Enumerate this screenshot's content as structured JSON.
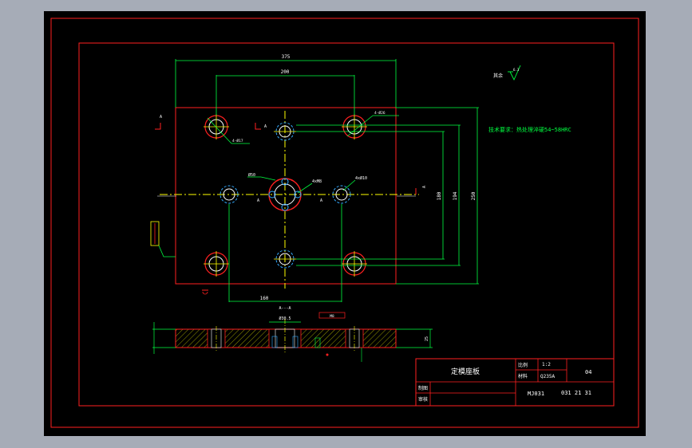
{
  "drawing": {
    "dimensions": {
      "overall_width": "375",
      "hole_spacing_width": "200",
      "bottom_width": "160",
      "overall_height": "250",
      "mid_height_194": "194",
      "mid_height_180": "180",
      "depth": "25"
    },
    "callouts": {
      "corner_bore_top_right": "4-Ø26",
      "corner_bore_top_left": "4-Ø17",
      "center_bore": "Ø50",
      "thread_4xM8": "4xM8",
      "side_hole_4x10": "4xØ10",
      "section_fit": "Ø30.5",
      "thread_side": "M8"
    },
    "section_markers": {
      "a_upper_left": "A",
      "a_upper_mid": "A",
      "a_right": "A",
      "a_center_left": "A",
      "a_center_right": "A",
      "section_title": "A---A"
    },
    "surface_finish": {
      "label": "其余",
      "value": "6.3"
    },
    "notes": {
      "tech_requirement": "技术要求：热处理淬硬54~58HRC"
    },
    "title_block": {
      "part_name": "定模座板",
      "scale_label": "比例",
      "scale_value": "1:2",
      "material_label": "材料",
      "material_value": "Q235A",
      "sheet_number": "04",
      "drawn_by_label": "制图",
      "checked_by_label": "审核",
      "drawing_code": "MJ031",
      "date": "031 21 31"
    }
  }
}
